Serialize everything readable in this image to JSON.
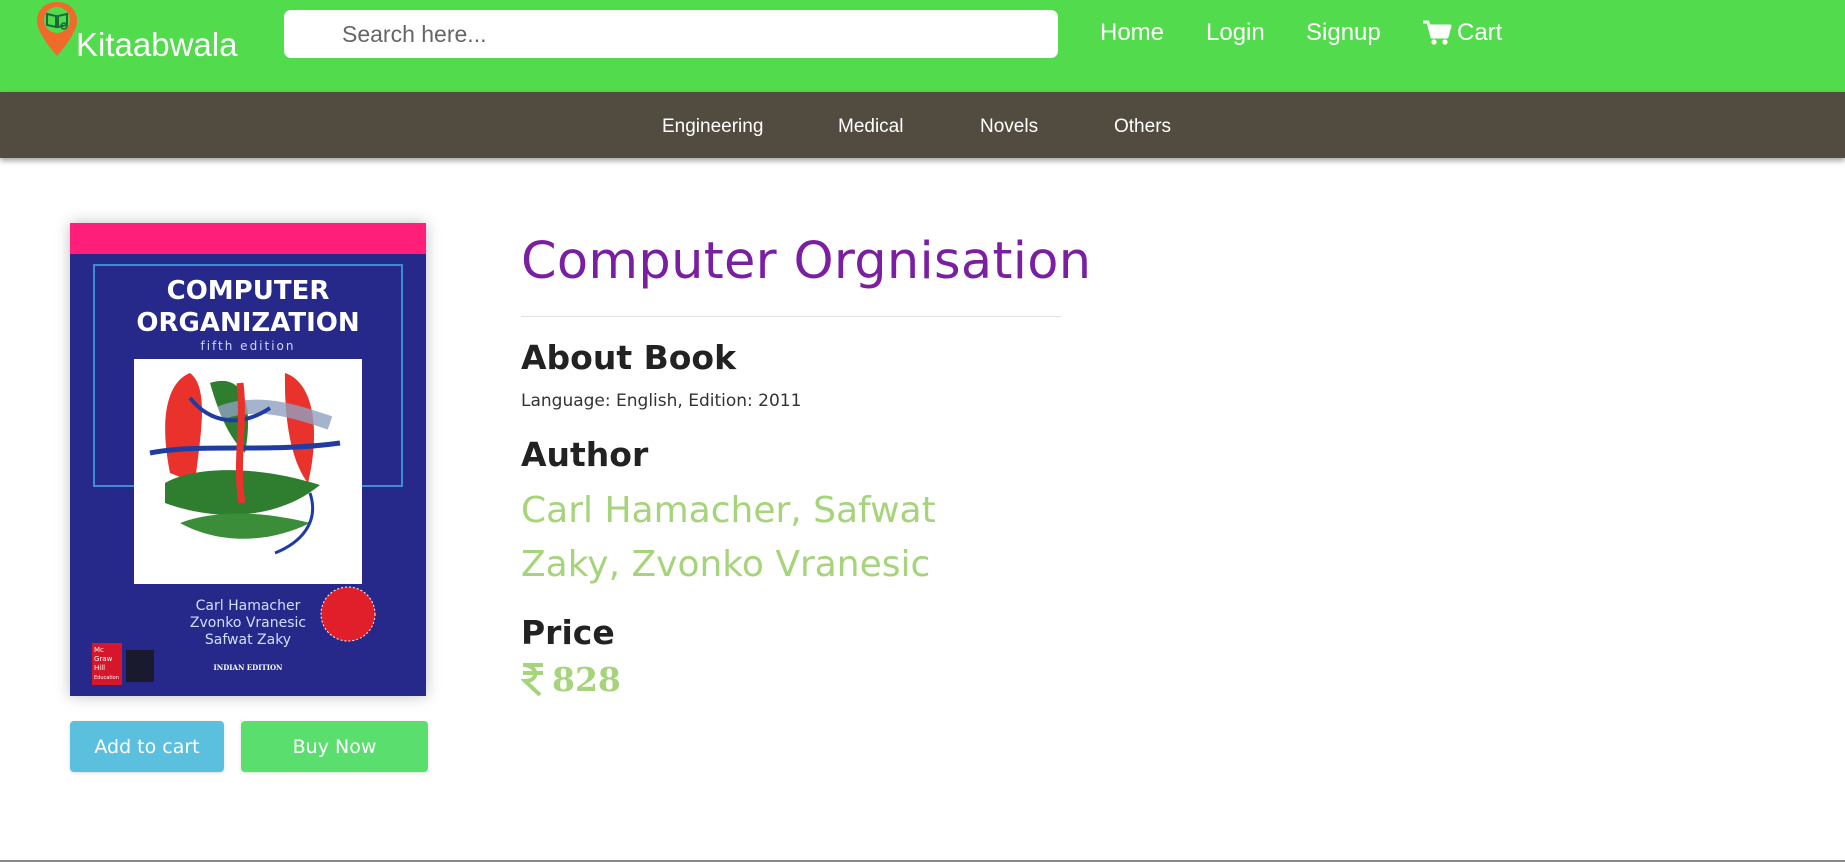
{
  "header": {
    "brand": "Kitaabwala",
    "search": {
      "placeholder": "Search here...",
      "value": ""
    },
    "nav": {
      "home": "Home",
      "login": "Login",
      "signup": "Signup",
      "cart": "Cart"
    }
  },
  "categories": [
    "Engineering",
    "Medical",
    "Novels",
    "Others"
  ],
  "cover": {
    "title_line1": "COMPUTER",
    "title_line2": "ORGANIZATION",
    "edition": "fifth edition",
    "authors": [
      "Carl Hamacher",
      "Zvonko Vranesic",
      "Safwat Zaky"
    ],
    "publisher": [
      "Mc",
      "Graw",
      "Hill",
      "Education"
    ],
    "badge": "INDIAN EDITION"
  },
  "actions": {
    "add_to_cart": "Add to cart",
    "buy_now": "Buy Now"
  },
  "book": {
    "title": "Computer Orgnisation",
    "about_heading": "About Book",
    "about_text": "Language: English, Edition: 2011",
    "author_heading": "Author",
    "author_text": "Carl Hamacher, Safwat Zaky, Zvonko Vranesic",
    "price_heading": "Price",
    "price": "828"
  },
  "colors": {
    "header_bg": "#52db4c",
    "category_bg": "#524c40",
    "title": "#7b1fa2",
    "accent_green": "#a5d47a",
    "add_cart_btn": "#5bc0de",
    "buy_now_btn": "#5ade6e"
  },
  "icons": {
    "logo": "map-pin-book-icon",
    "search": "search-icon",
    "cart": "shopping-cart-icon",
    "currency": "rupee-icon"
  }
}
